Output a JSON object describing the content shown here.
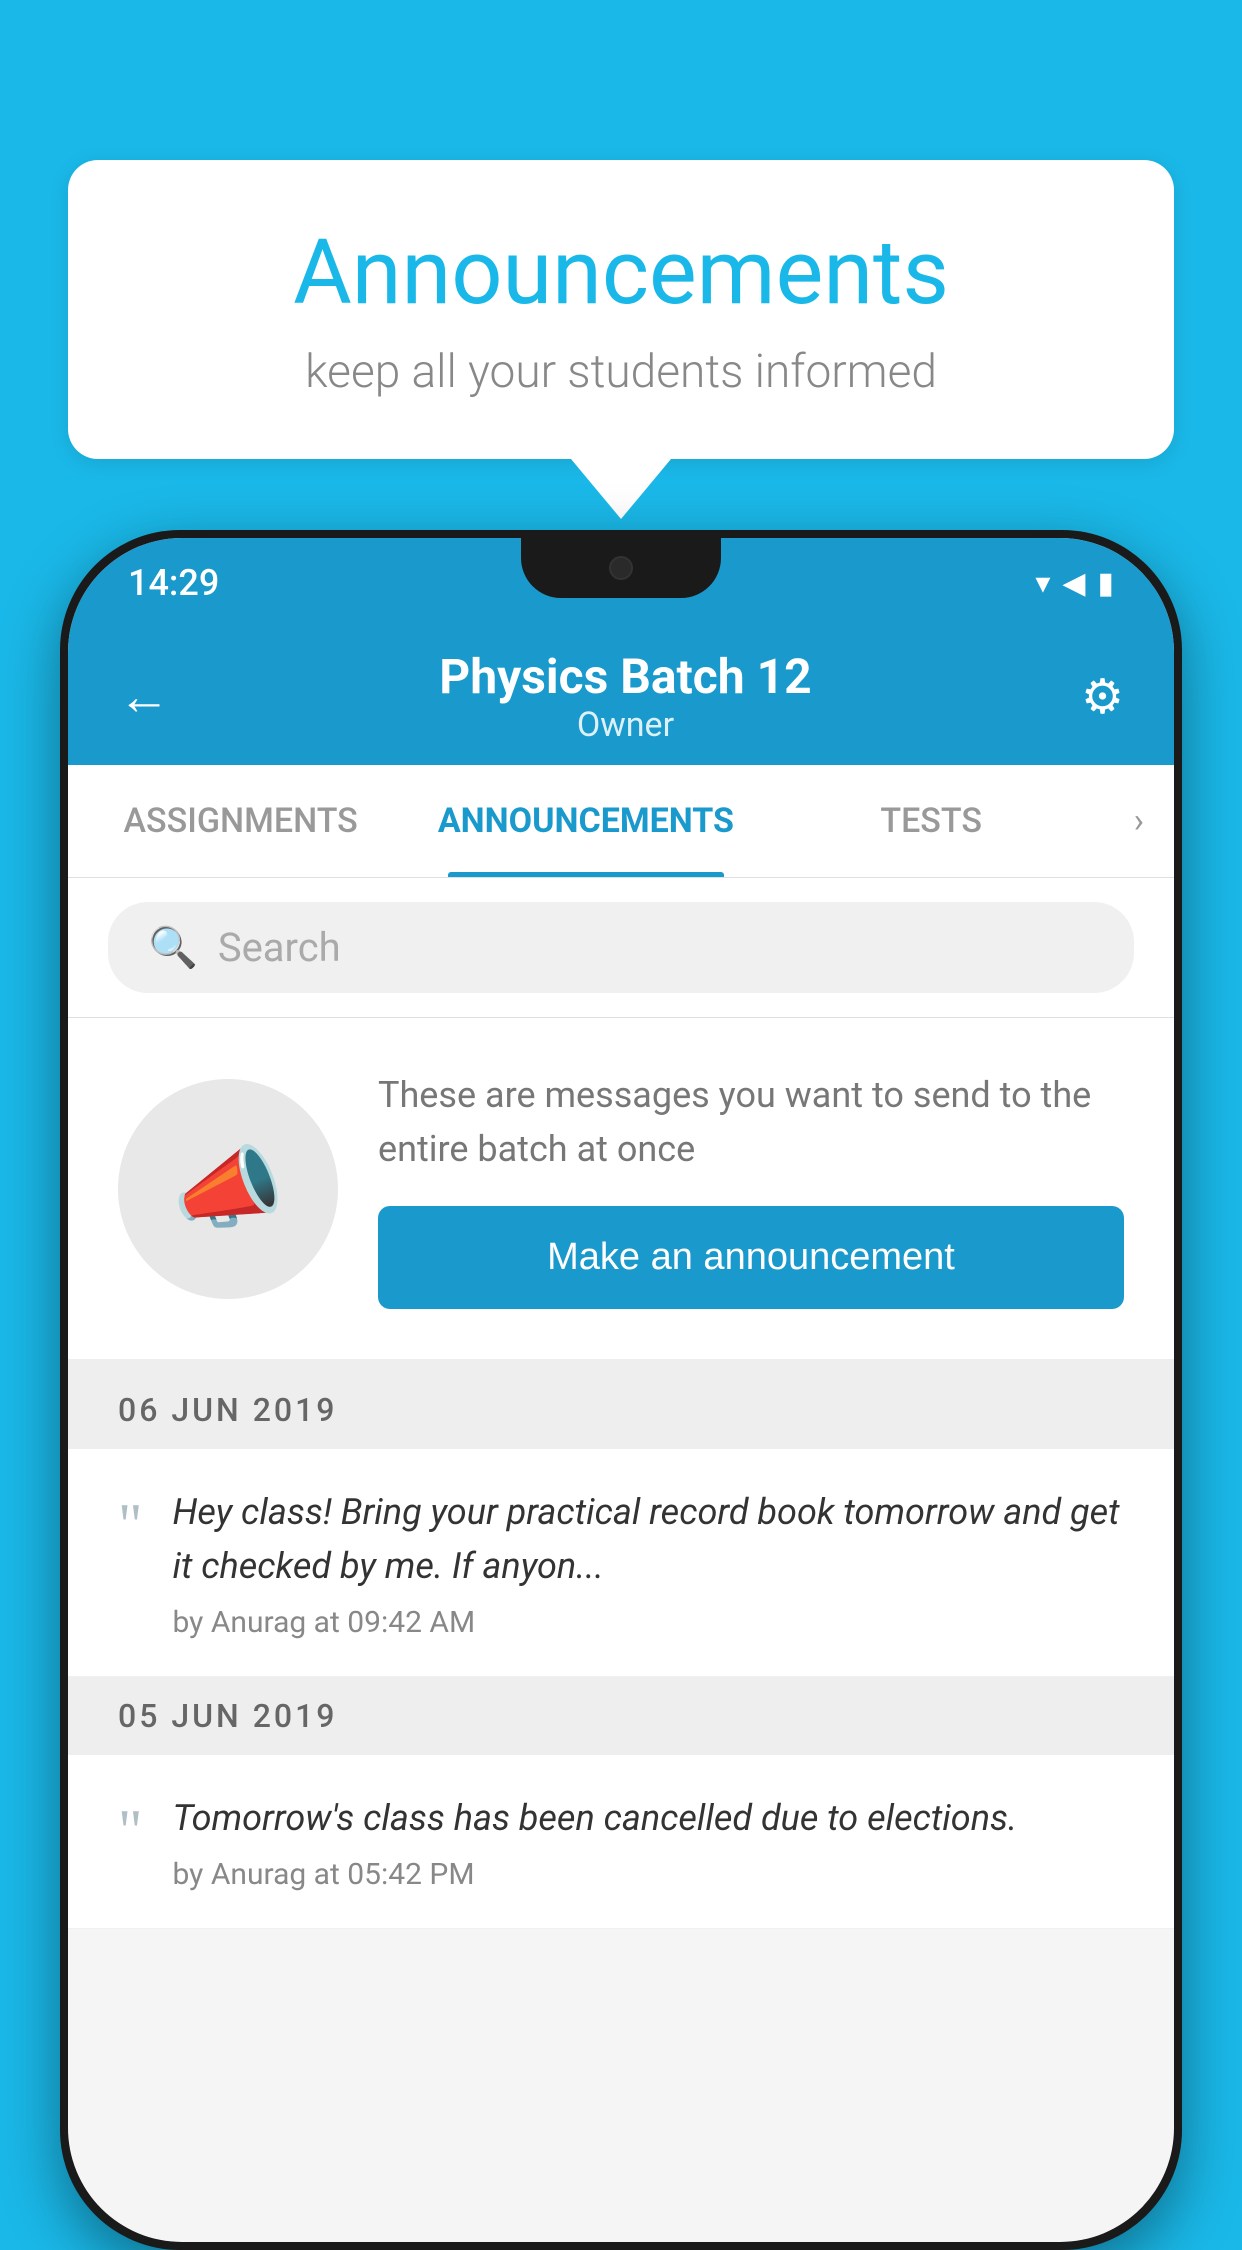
{
  "background_color": "#1ab8e8",
  "speech_bubble": {
    "title": "Announcements",
    "subtitle": "keep all your students informed"
  },
  "phone": {
    "status_bar": {
      "time": "14:29",
      "wifi": "▾",
      "signal": "▲",
      "battery": "▮"
    },
    "header": {
      "title": "Physics Batch 12",
      "subtitle": "Owner",
      "back_label": "←",
      "settings_label": "⚙"
    },
    "tabs": [
      {
        "label": "ASSIGNMENTS",
        "active": false
      },
      {
        "label": "ANNOUNCEMENTS",
        "active": true
      },
      {
        "label": "TESTS",
        "active": false
      }
    ],
    "tabs_more": "›",
    "search": {
      "placeholder": "Search"
    },
    "announcement_prompt": {
      "description": "These are messages you want to send to the entire batch at once",
      "button_label": "Make an announcement"
    },
    "date_sections": [
      {
        "date": "06  JUN  2019",
        "announcements": [
          {
            "text": "Hey class! Bring your practical record book tomorrow and get it checked by me. If anyon...",
            "meta": "by Anurag at 09:42 AM"
          }
        ]
      },
      {
        "date": "05  JUN  2019",
        "announcements": [
          {
            "text": "Tomorrow's class has been cancelled due to elections.",
            "meta": "by Anurag at 05:42 PM"
          }
        ]
      }
    ]
  }
}
